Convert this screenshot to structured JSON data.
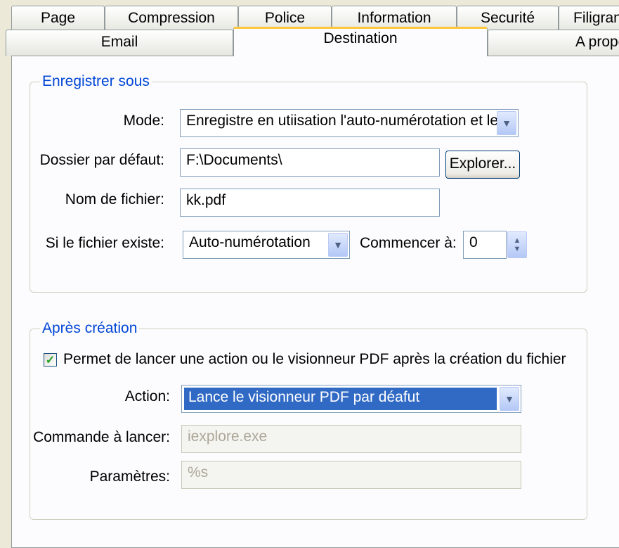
{
  "tabs_row1": [
    "Page",
    "Compression",
    "Police",
    "Information",
    "Securité",
    "Filigrane"
  ],
  "tabs_row2": [
    "Email",
    "Destination",
    "A propos"
  ],
  "save_group": {
    "legend": "Enregistrer sous",
    "mode_label": "Mode:",
    "mode_value": "Enregistre en utiisation l'auto-numérotation et le",
    "folder_label": "Dossier par défaut:",
    "folder_value": "F:\\Documents\\",
    "browse_label": "Explorer...",
    "filename_label": "Nom de fichier:",
    "filename_value": "kk.pdf",
    "exists_label": "Si le fichier existe:",
    "exists_value": "Auto-numérotation",
    "start_label": "Commencer à:",
    "start_value": "0"
  },
  "after_group": {
    "legend": "Après création",
    "checkbox_label": "Permet de lancer une action ou le visionneur PDF après la création du fichier",
    "checked": true,
    "action_label": "Action:",
    "action_value": "Lance le visionneur PDF par déafut",
    "command_label": "Commande à lancer:",
    "command_value": "iexplore.exe",
    "params_label": "Paramètres:",
    "params_value": "%s"
  },
  "colors": {
    "accent": "#0046D5",
    "selection": "#316AC5",
    "tab_highlight": "#FFC83C"
  }
}
